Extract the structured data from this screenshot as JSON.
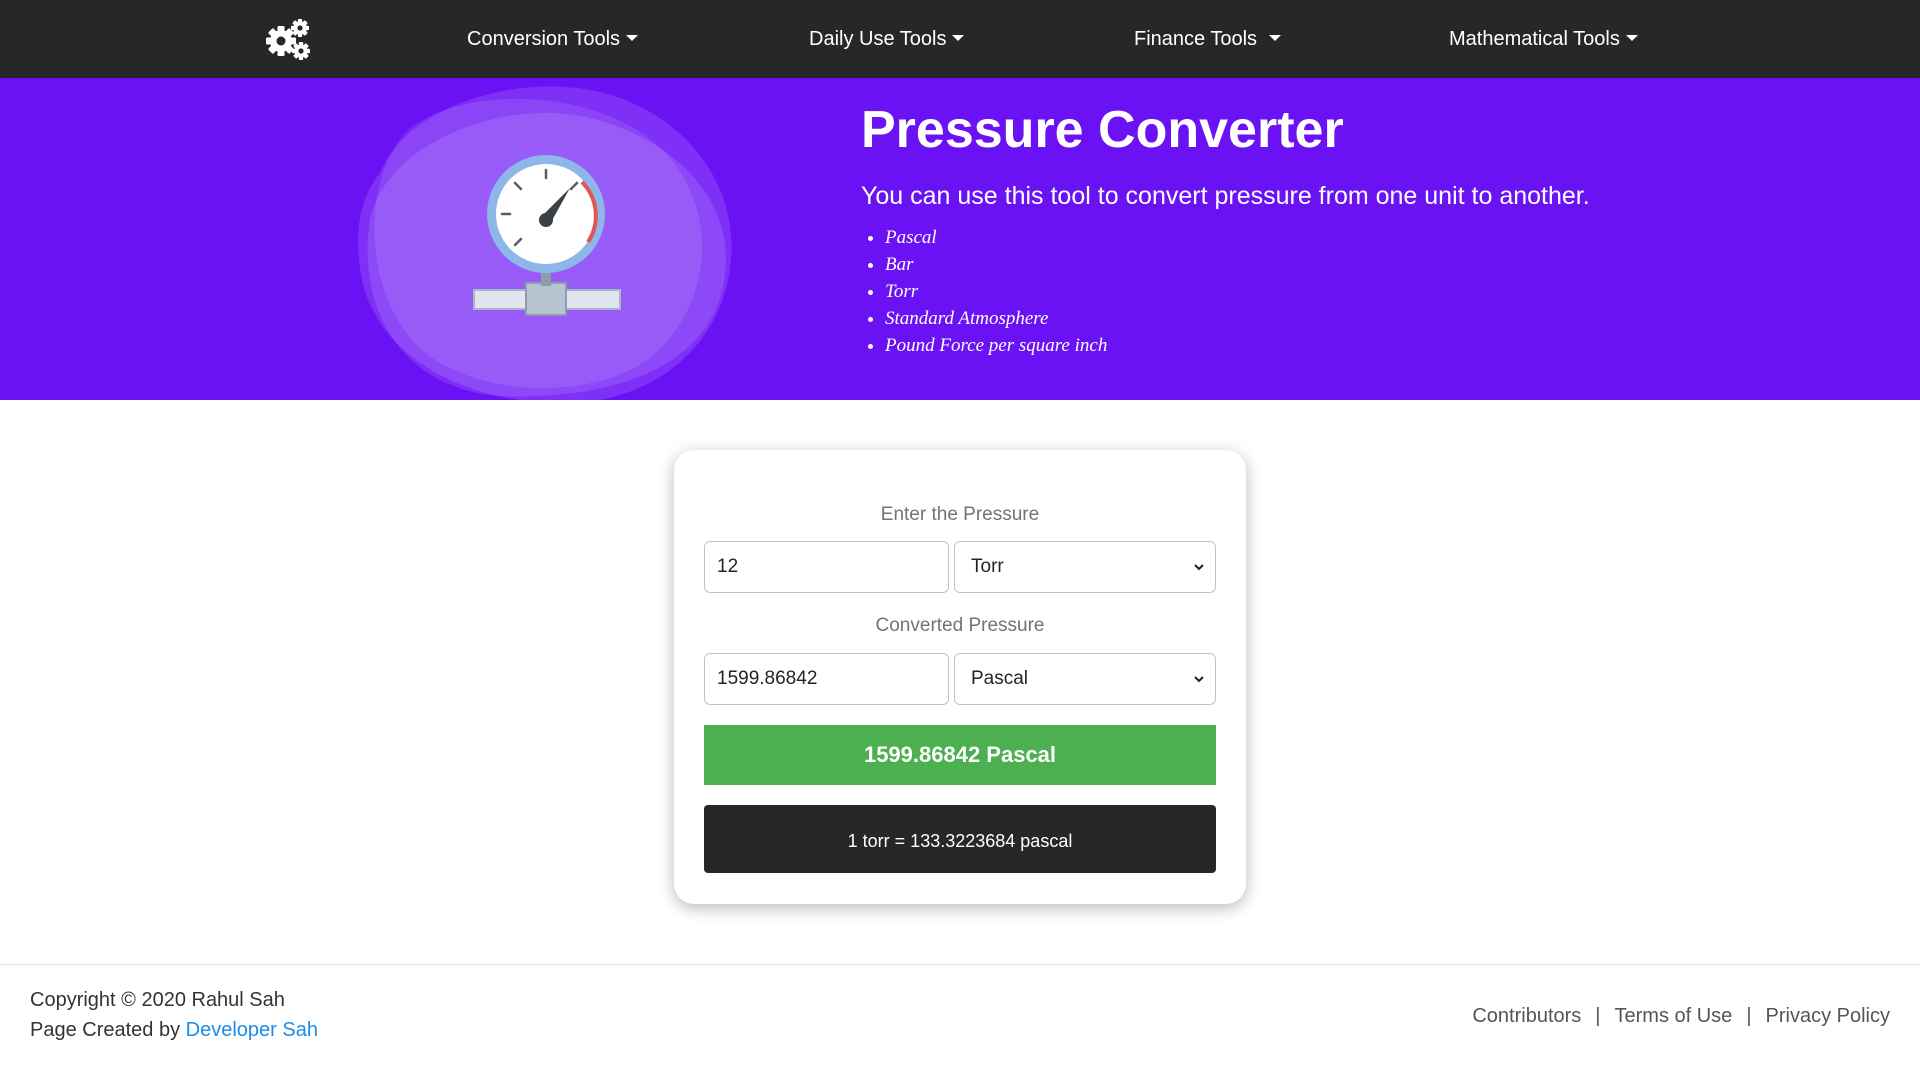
{
  "colors": {
    "navbar": "#272727",
    "hero_background": "#6b12f5",
    "result_background": "#4caf50",
    "formula_background": "#272727",
    "link": "#1a8be8"
  },
  "navbar": {
    "logo_icon": "gears-icon",
    "items": [
      {
        "label": "Conversion Tools"
      },
      {
        "label": "Daily Use Tools"
      },
      {
        "label": "Finance Tools"
      },
      {
        "label": "Mathematical Tools"
      }
    ]
  },
  "hero": {
    "illustration": "pressure-gauge-icon",
    "title": "Pressure Converter",
    "description": "You can use this tool to convert pressure from one unit to another.",
    "units": [
      "Pascal",
      "Bar",
      "Torr",
      "Standard Atmosphere",
      "Pound Force per square inch"
    ]
  },
  "converter": {
    "input_label": "Enter the Pressure",
    "input_value": "12",
    "input_unit": "Torr",
    "output_label": "Converted Pressure",
    "output_value": "1599.86842",
    "output_unit": "Pascal",
    "result": "1599.86842 Pascal",
    "formula": "1 torr = 133.3223684 pascal"
  },
  "footer": {
    "copyright": "Copyright © 2020 Rahul Sah",
    "credit_prefix": "Page Created by ",
    "credit_link": "Developer Sah",
    "links": [
      "Contributors",
      "Terms of Use",
      "Privacy Policy"
    ],
    "separator": "|"
  }
}
